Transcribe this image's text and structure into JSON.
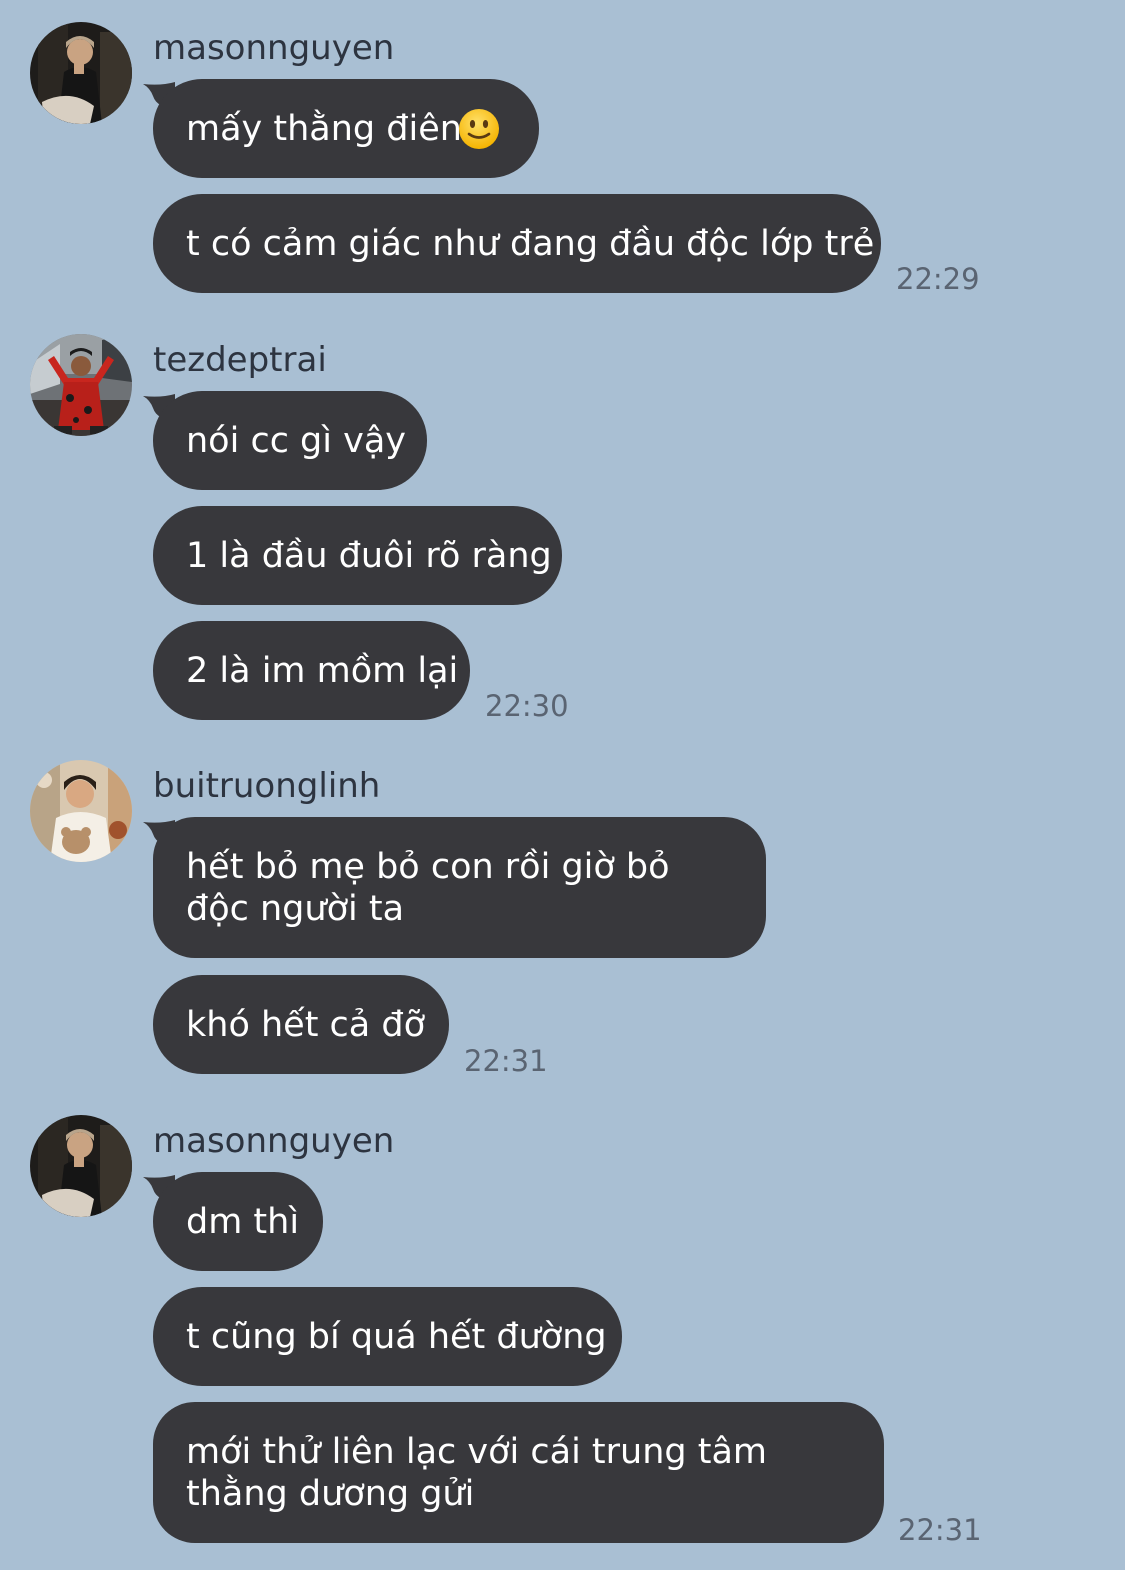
{
  "chat": {
    "groups": [
      {
        "sender": "masonnguyen",
        "avatar_icon": "avatar-masonnguyen",
        "messages": [
          {
            "text": "mấy thằng điên",
            "emoji": "slightly-smiling-face-icon"
          },
          {
            "text": "t có cảm giác như đang đầu độc lớp trẻ"
          }
        ],
        "time": "22:29"
      },
      {
        "sender": "tezdeptrai",
        "avatar_icon": "avatar-tezdeptrai",
        "messages": [
          {
            "text": "nói cc gì vậy"
          },
          {
            "text": "1 là đầu đuôi rõ ràng"
          },
          {
            "text": "2 là im mồm lại"
          }
        ],
        "time": "22:30"
      },
      {
        "sender": "buitruonglinh",
        "avatar_icon": "avatar-buitruonglinh",
        "messages": [
          {
            "text": "hết bỏ mẹ bỏ con rồi giờ bỏ độc người ta"
          },
          {
            "text": "khó hết cả đỡ"
          }
        ],
        "time": "22:31"
      },
      {
        "sender": "masonnguyen",
        "avatar_icon": "avatar-masonnguyen",
        "messages": [
          {
            "text": "dm thì"
          },
          {
            "text": "t cũng bí quá hết đường"
          },
          {
            "text": "mới thử liên lạc với cái trung tâm thằng dương gửi"
          }
        ],
        "time": "22:31"
      }
    ]
  },
  "colors": {
    "background": "#a9bfd3",
    "bubble": "#38383c",
    "bubble_text": "#ffffff",
    "sender_text": "#2d3440",
    "time_text": "#5a6472"
  }
}
